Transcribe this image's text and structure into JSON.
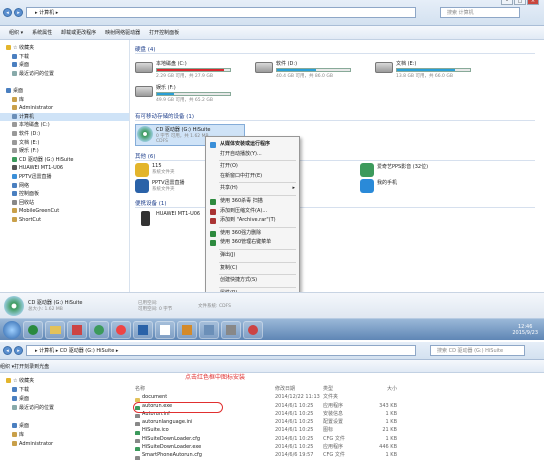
{
  "top": {
    "breadcrumb": "▸ 计算机 ▸",
    "search": "搜索 计算机",
    "toolbar": [
      "组织 ▾",
      "系统属性",
      "卸载或更改程序",
      "映射网络驱动器",
      "打开控制面板"
    ],
    "nav": [
      {
        "t": "☆ 收藏夹",
        "c": "#e3b52c",
        "g": 1
      },
      {
        "t": "下载",
        "c": "#4a7fc0"
      },
      {
        "t": "桌面",
        "c": "#4a7fc0"
      },
      {
        "t": "最近访问的位置",
        "c": "#8aa"
      },
      {
        "t": "",
        "c": ""
      },
      {
        "t": "桌面",
        "c": "#4a7fc0",
        "g": 1
      },
      {
        "t": "库",
        "c": "#c9a04a"
      },
      {
        "t": "Administrator",
        "c": "#c9a04a"
      },
      {
        "t": "计算机",
        "c": "#6b8fb8",
        "sel": 1
      },
      {
        "t": "本地磁盘 (C:)",
        "c": "#999"
      },
      {
        "t": "软件 (D:)",
        "c": "#999"
      },
      {
        "t": "文档 (E:)",
        "c": "#999"
      },
      {
        "t": "娱乐 (F:)",
        "c": "#999"
      },
      {
        "t": "CD 驱动器 (G:) HiSuite",
        "c": "#3c9a5c"
      },
      {
        "t": "HUAWEI MT1-U06",
        "c": "#555"
      },
      {
        "t": "PPTV迅雷直播",
        "c": "#3a8fd8"
      },
      {
        "t": "网络",
        "c": "#4a7fc0"
      },
      {
        "t": "控制面板",
        "c": "#4a7fc0"
      },
      {
        "t": "回收站",
        "c": "#888"
      },
      {
        "t": "MobileGreenCut",
        "c": "#c9a04a"
      },
      {
        "t": "ShortCut",
        "c": "#c9a04a"
      }
    ],
    "groups": {
      "hdd": "硬盘 (4)",
      "removable": "有可移动存储的设备 (1)",
      "other": "其他 (6)",
      "portable": "便携设备 (1)"
    },
    "drives": [
      {
        "name": "本地磁盘 (C:)",
        "free": "2.29 GB 可用，共 27.9 GB",
        "fill": 0.92,
        "color": "#d9262e"
      },
      {
        "name": "软件 (D:)",
        "free": "40.4 GB 可用，共 86.0 GB",
        "fill": 0.53,
        "color": "#2a9fd6"
      },
      {
        "name": "文档 (E:)",
        "free": "13.8 GB 可用，共 66.0 GB",
        "fill": 0.79,
        "color": "#2a9fd6"
      },
      {
        "name": "娱乐 (F:)",
        "free": "49.9 GB 可用，共 65.2 GB",
        "fill": 0.23,
        "color": "#2a9fd6"
      }
    ],
    "cd": {
      "name": "CD 驱动器 (G:) HiSuite",
      "free": "0 字节 可用，共 1.62 MB",
      "fs": "CDFS"
    },
    "other": [
      {
        "n": "115",
        "s": "系统文件夹"
      },
      {
        "n": "爱奇艺PPS影音 (32位)",
        "s": ""
      },
      {
        "n": "PPTV迅雷直播",
        "s": "系统文件夹"
      },
      {
        "n": "我的手机",
        "s": ""
      }
    ],
    "portable": {
      "n": "HUAWEI MT1-U06",
      "s": ""
    },
    "menu": [
      {
        "t": "从媒体安装或运行程序",
        "bold": 1,
        "c": "#3a8fd8"
      },
      {
        "t": "打开自动播放(Y)...",
        "c": ""
      },
      {
        "sep": 1
      },
      {
        "t": "打开(O)",
        "c": ""
      },
      {
        "t": "在新窗口中打开(E)",
        "c": ""
      },
      {
        "sep": 1
      },
      {
        "t": "共享(H)",
        "c": "",
        "arrow": 1
      },
      {
        "sep": 1
      },
      {
        "t": "使用 360杀毒 扫描",
        "c": "#2d8a3e"
      },
      {
        "t": "添加到压缩文件(A)...",
        "c": "#a33"
      },
      {
        "t": "添加到 \"Archive.rar\"(T)",
        "c": "#a33"
      },
      {
        "sep": 1
      },
      {
        "t": "使用 360强力删除",
        "c": "#2d8a3e"
      },
      {
        "t": "使用 360管理右键菜单",
        "c": "#2d8a3e"
      },
      {
        "sep": 1
      },
      {
        "t": "弹出(J)",
        "c": ""
      },
      {
        "sep": 1
      },
      {
        "t": "复制(C)",
        "c": ""
      },
      {
        "sep": 1
      },
      {
        "t": "创建快捷方式(S)",
        "c": ""
      },
      {
        "sep": 1
      },
      {
        "t": "属性(R)",
        "c": ""
      }
    ],
    "status": {
      "name": "CD 驱动器 (G:) HiSuite",
      "used": "已用空间:",
      "free": "可用空间: 0 字节",
      "total": "总大小: 1.62 MB",
      "fs": "文件系统: CDFS"
    },
    "clock": {
      "time": "12:46",
      "date": "2015/9/23"
    }
  },
  "bottom": {
    "breadcrumb": "▸ 计算机 ▸ CD 驱动器 (G:) HiSuite ▸",
    "search": "搜索 CD 驱动器 (G:) HiSuite",
    "toolbar": [
      "组织 ▾",
      "打开",
      "刻录到光盘"
    ],
    "nav": [
      {
        "t": "☆ 收藏夹",
        "c": "#e3b52c"
      },
      {
        "t": "下载",
        "c": "#4a7fc0"
      },
      {
        "t": "桌面",
        "c": "#4a7fc0"
      },
      {
        "t": "最近访问的位置",
        "c": "#8aa"
      },
      {
        "t": "",
        "c": ""
      },
      {
        "t": "桌面",
        "c": "#4a7fc0"
      },
      {
        "t": "库",
        "c": "#c9a04a"
      },
      {
        "t": "Administrator",
        "c": "#c9a04a"
      }
    ],
    "headers": [
      "名称",
      "修改日期",
      "类型",
      "大小"
    ],
    "annotation": "点击红色框中图标安装",
    "files": [
      {
        "n": "document",
        "d": "2014/12/22 11:13",
        "t": "文件夹",
        "s": "",
        "c": "#e3c25a"
      },
      {
        "n": "autorun.exe",
        "d": "2014/6/1 10:25",
        "t": "应用程序",
        "s": "343 KB",
        "c": "#3c9a5c"
      },
      {
        "n": "Autorun.inf",
        "d": "2014/6/1 10:25",
        "t": "安装信息",
        "s": "1 KB",
        "c": "#888"
      },
      {
        "n": "autorunlanguage.ini",
        "d": "2014/6/1 10:25",
        "t": "配置设置",
        "s": "1 KB",
        "c": "#888"
      },
      {
        "n": "HiSuite.ico",
        "d": "2014/6/1 10:25",
        "t": "图标",
        "s": "21 KB",
        "c": "#3c9a5c"
      },
      {
        "n": "HiSuiteDownLoader.cfg",
        "d": "2014/6/1 10:25",
        "t": "CFG 文件",
        "s": "1 KB",
        "c": "#888"
      },
      {
        "n": "HiSuiteDownLoader.exe",
        "d": "2014/6/1 10:25",
        "t": "应用程序",
        "s": "446 KB",
        "c": "#3c9a5c"
      },
      {
        "n": "SmartPhoneAutorun.cfg",
        "d": "2014/6/6 19:57",
        "t": "CFG 文件",
        "s": "1 KB",
        "c": "#888"
      }
    ]
  }
}
